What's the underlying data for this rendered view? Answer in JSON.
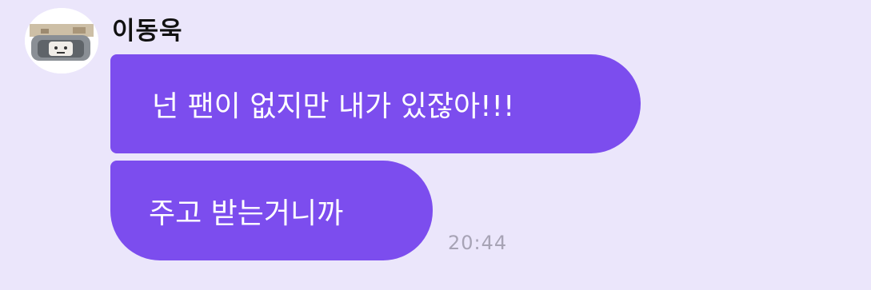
{
  "chat": {
    "sender": {
      "name": "이동욱",
      "avatar_icon": "profile-photo"
    },
    "messages": [
      {
        "text": "넌 팬이 없지만 내가 있잖아!!!"
      },
      {
        "text": "주고 받는거니까"
      }
    ],
    "timestamp": "20:44",
    "colors": {
      "background": "#ebe6fb",
      "bubble": "#7c4dee",
      "bubble_text": "#ffffff",
      "timestamp": "#a7a3b5"
    }
  }
}
